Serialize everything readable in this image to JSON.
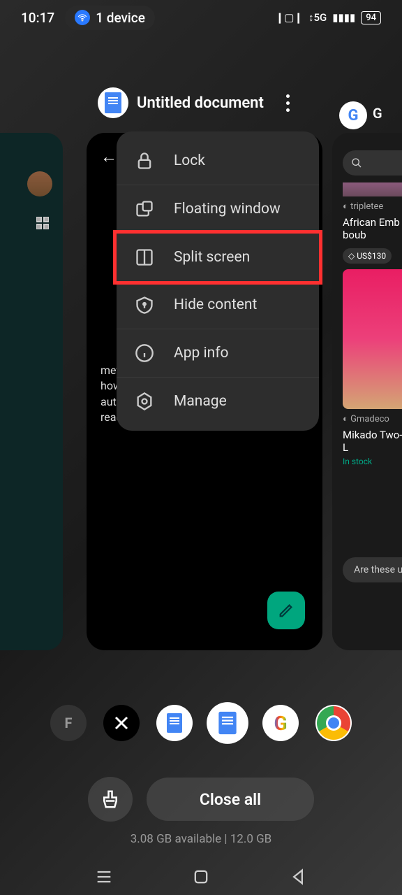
{
  "status_bar": {
    "time": "10:17",
    "device_label": "1 device",
    "network": "5G",
    "battery": "94"
  },
  "app_header": {
    "title": "Untitled document"
  },
  "context_menu": {
    "items": [
      {
        "label": "Lock",
        "icon": "lock-icon"
      },
      {
        "label": "Floating window",
        "icon": "floating-window-icon"
      },
      {
        "label": "Split screen",
        "icon": "split-screen-icon",
        "highlighted": true
      },
      {
        "label": "Hide content",
        "icon": "hide-content-icon"
      },
      {
        "label": "App info",
        "icon": "info-icon"
      },
      {
        "label": "Manage",
        "icon": "manage-icon"
      }
    ]
  },
  "main_card": {
    "body_text": "methods require some technical know-how. Otherwise, it's simpler to wait for the automatic over-the-air (OTA) update to reach your device."
  },
  "right_card": {
    "shop_label": "tripletee",
    "product1": "African Emb Mikado boub",
    "price": "US$130",
    "shop2": "Gmadeco",
    "product2": "Mikado Two- Rich Aunty L",
    "stock": "In stock",
    "feedback": "Are these useful?"
  },
  "carousel": {
    "items": [
      "F",
      "X",
      "Docs",
      "Docs",
      "G",
      "Chrome"
    ]
  },
  "bottom": {
    "close_all": "Close all",
    "memory": "3.08 GB available | 12.0 GB"
  }
}
